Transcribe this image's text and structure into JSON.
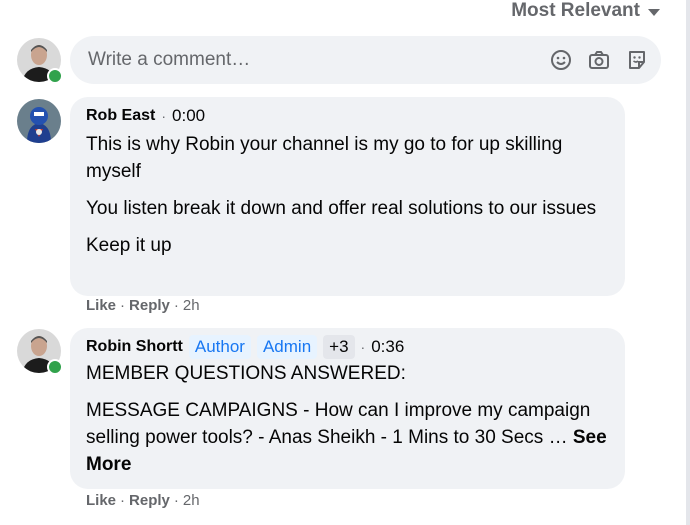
{
  "sort": {
    "label": "Most Relevant"
  },
  "composer": {
    "placeholder": "Write a comment…"
  },
  "comments": [
    {
      "author": "Rob East",
      "time": "0:00",
      "paragraphs": [
        "This is why Robin your channel is my go to for up skilling myself",
        "You listen break it down and offer real solutions to our issues",
        "Keep it up"
      ],
      "actions": {
        "like": "Like",
        "reply": "Reply",
        "age": "2h"
      }
    },
    {
      "author": "Robin Shortt",
      "badges": [
        "Author",
        "Admin",
        "+3"
      ],
      "time": "0:36",
      "paragraphs": [
        "MEMBER QUESTIONS ANSWERED:",
        "MESSAGE CAMPAIGNS - How can I improve my campaign selling power tools? - Anas Sheikh - 1 Mins to 30 Secs …"
      ],
      "see_more": "See More",
      "actions": {
        "like": "Like",
        "reply": "Reply",
        "age": "2h"
      }
    }
  ],
  "colors": {
    "bubble": "#f0f2f5",
    "online": "#31a24c",
    "badge_text": "#1877f2",
    "badge_bg": "#e7f3ff"
  }
}
